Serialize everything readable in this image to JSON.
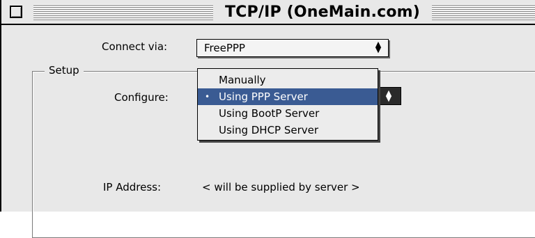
{
  "window": {
    "title": "TCP/IP (OneMain.com)"
  },
  "connect_via": {
    "label": "Connect via:",
    "selected": "FreePPP"
  },
  "setup": {
    "group_title": "Setup",
    "configure_label": "Configure:",
    "configure_menu": {
      "items": [
        "Manually",
        "Using PPP Server",
        "Using BootP Server",
        "Using DHCP Server"
      ],
      "selected_index": 1,
      "check_mark": "•"
    },
    "ip_address_label": "IP Address:",
    "ip_address_value": "< will be supplied by server >"
  },
  "colors": {
    "window_bg": "#e8e8e8",
    "menu_highlight": "#3a5b93"
  },
  "icons": {
    "close_box": "close-box-icon",
    "popup_arrows": "updown-arrows-icon"
  }
}
